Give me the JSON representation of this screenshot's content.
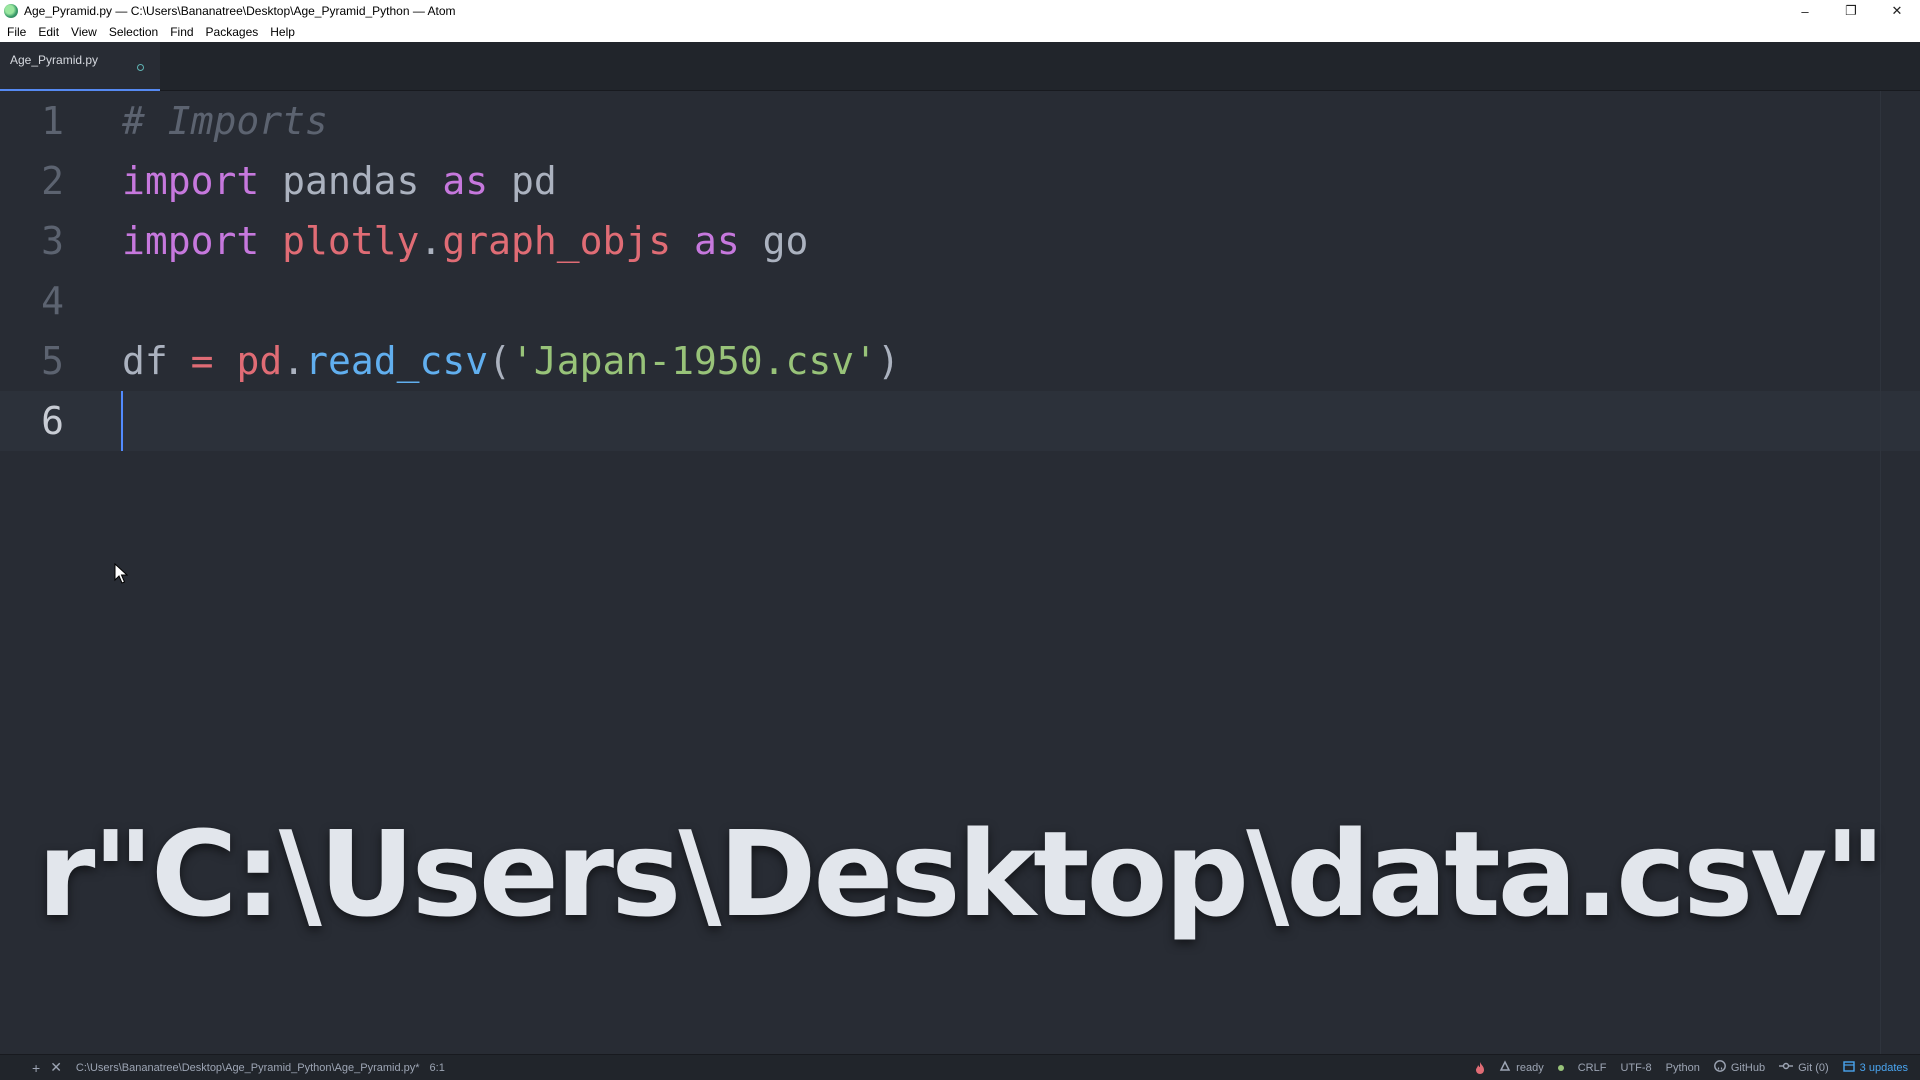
{
  "window": {
    "title": "Age_Pyramid.py — C:\\Users\\Bananatree\\Desktop\\Age_Pyramid_Python — Atom",
    "controls": {
      "minimize": "–",
      "restore": "❐",
      "close": "✕"
    }
  },
  "menu": {
    "items": [
      {
        "label": "File"
      },
      {
        "label": "Edit"
      },
      {
        "label": "View"
      },
      {
        "label": "Selection"
      },
      {
        "label": "Find"
      },
      {
        "label": "Packages"
      },
      {
        "label": "Help"
      }
    ]
  },
  "tabs": [
    {
      "label": "Age_Pyramid.py",
      "modified": true
    }
  ],
  "editor": {
    "line_numbers": [
      "1",
      "2",
      "3",
      "4",
      "5",
      "6"
    ],
    "active_line": "6",
    "tokens": {
      "line1_comment": "# Imports",
      "line2_import": "import",
      "line2_module": "pandas",
      "line2_as": "as",
      "line2_alias": "pd",
      "line3_import": "import",
      "line3_module1": "plotly",
      "line3_dot": ".",
      "line3_module2": "graph_objs",
      "line3_as": "as",
      "line3_alias": "go",
      "line5_var": "df",
      "line5_eq": "=",
      "line5_obj": "pd",
      "line5_dot": ".",
      "line5_func": "read_csv",
      "line5_open": "(",
      "line5_str": "'Japan-1950.csv'",
      "line5_close": ")"
    }
  },
  "overlay": {
    "text": "r\"C:\\Users\\Desktop\\data.csv\""
  },
  "statusbar": {
    "icons": {
      "add": "+",
      "close": "✕"
    },
    "file_path": "C:\\Users\\Bananatree\\Desktop\\Age_Pyramid_Python\\Age_Pyramid.py*",
    "cursor_position": "6:1",
    "status": "ready",
    "line_ending": "CRLF",
    "encoding": "UTF-8",
    "grammar": "Python",
    "github": "GitHub",
    "git": "Git (0)",
    "updates": "3 updates"
  },
  "colors": {
    "background": "#282c34",
    "keyword": "#c678dd",
    "module": "#e06c75",
    "function": "#61afef",
    "string": "#98c379",
    "comment": "#5c6370",
    "updates": "#4aa5f0"
  }
}
